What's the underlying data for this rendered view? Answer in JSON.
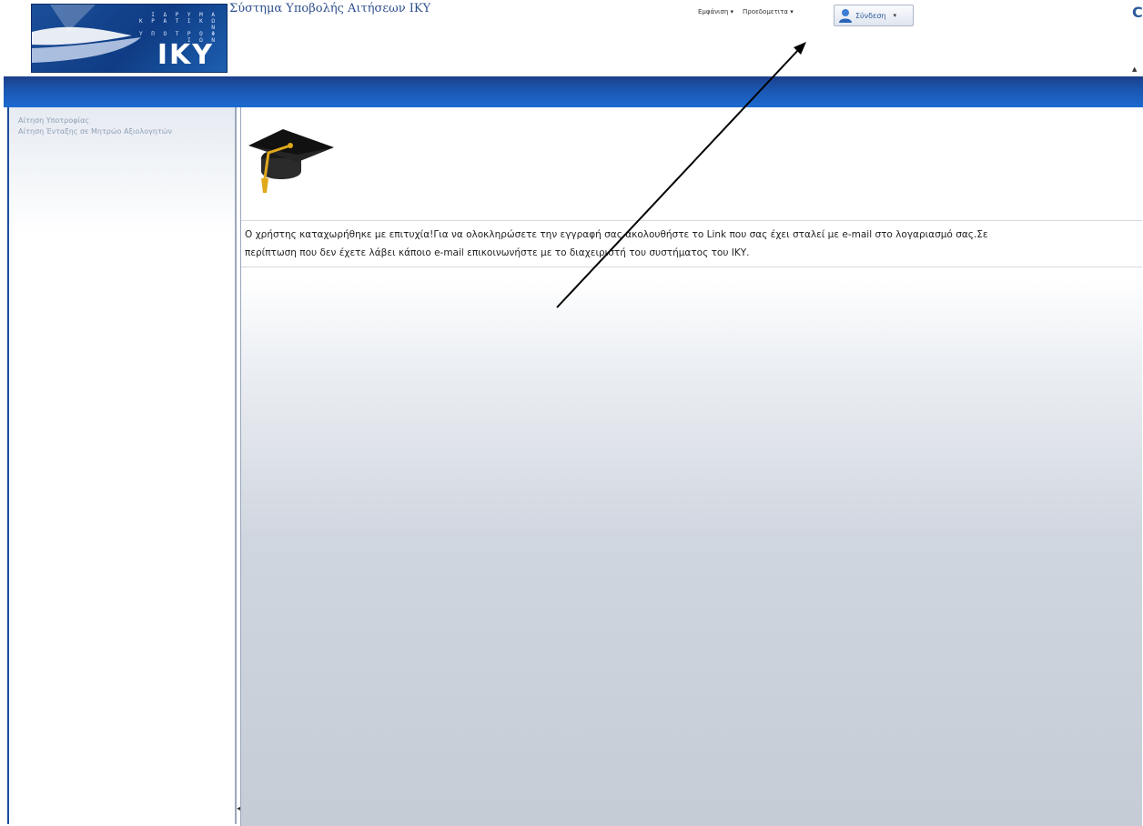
{
  "header": {
    "logo": {
      "small_lines": [
        "Ι Δ Ρ Υ Μ Α",
        "Κ Ρ Α Τ Ι Κ Ω Ν",
        "Υ Π Ο Τ Ρ Ο Φ Ι Ω Ν"
      ],
      "big_text": "ΙΚΥ"
    },
    "app_title": "Σύστημα Υποβολής Αιτήσεων ΙΚΥ",
    "menu": [
      "Εμφάνιση ▾",
      "Προεδομετιτα ▾"
    ],
    "login_label": "Σύνδεση",
    "login_caret": "▾",
    "corner_icon": "C",
    "corner_tri": "▲"
  },
  "sidebar": {
    "items": [
      "Αίτηση Υποτροφίας",
      "Αίτηση Ένταξης σε Μητρώο Αξιολογητών"
    ]
  },
  "main": {
    "icon": "graduation-cap-icon",
    "message_line1": "Ο χρήστης καταχωρήθηκε με επιτυχία!Για να ολοκληρώσετε την εγγραφή σας ακολουθήστε το Link που σας έχει σταλεί με e-mail στο λογαριασμό σας.Σε",
    "message_line2": "περίπτωση που δεν έχετε λάβει κάποιο e-mail επικοινωνήστε με το διαχειριστή του συστήματος του ΙΚΥ."
  },
  "colors": {
    "brand_blue": "#1b4f9a",
    "band_blue": "#1c6ad0",
    "sidebar_text": "#8fa0b5"
  }
}
